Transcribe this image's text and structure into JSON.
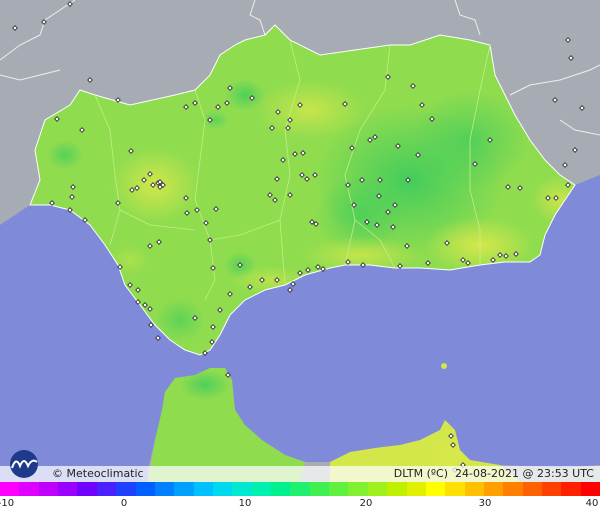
{
  "map": {
    "brand": "Meteoclimatic",
    "variable": "DLTM (ºC)",
    "date": "24-08-2021",
    "time": "23:53 UTC",
    "colors": {
      "sea": "#7f8ad8",
      "land_outside": "#a7abb3",
      "main_green": "#8fdc4f",
      "cool_green": "#4fcf5b",
      "warm_yellow": "#d4e74a"
    }
  },
  "scale": {
    "ticks": [
      "-10",
      "0",
      "10",
      "20",
      "30",
      "40"
    ],
    "colors": [
      "#ff00ff",
      "#e000ff",
      "#c000ff",
      "#9a00ff",
      "#7000ff",
      "#4a20ff",
      "#2040ff",
      "#0060ff",
      "#0080ff",
      "#00a0ff",
      "#00c0ff",
      "#00d8f0",
      "#00e8d0",
      "#00f0b0",
      "#00f090",
      "#20f070",
      "#40f050",
      "#60f040",
      "#80f030",
      "#a0f020",
      "#c0f000",
      "#e0f000",
      "#ffff00",
      "#ffe000",
      "#ffc000",
      "#ffa000",
      "#ff8000",
      "#ff6000",
      "#ff4000",
      "#ff2000",
      "#ff0000"
    ]
  }
}
